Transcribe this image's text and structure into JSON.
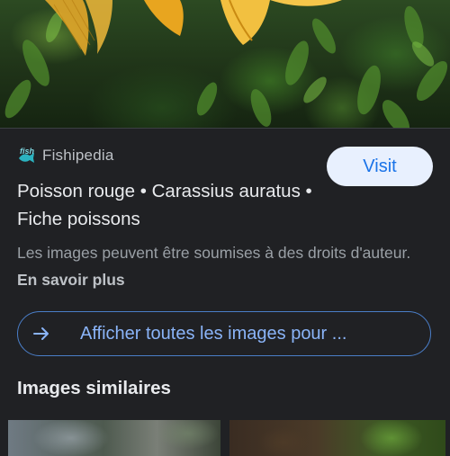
{
  "source": {
    "logo_icon": "fishipedia-logo-icon",
    "logo_text": "fish",
    "name": "Fishipedia"
  },
  "visit_button": {
    "label": "Visit"
  },
  "title": "Poisson rouge • Carassius auratus • Fiche poissons",
  "notice": {
    "text": "Les images peuvent être soumises à des droits d'auteur.",
    "learn_more": "En savoir plus"
  },
  "all_images": {
    "icon": "arrow-right-icon",
    "label": "Afficher toutes les images pour ..."
  },
  "similar": {
    "heading": "Images similaires"
  },
  "colors": {
    "background": "#202124",
    "accent": "#8ab4f8",
    "visit_bg": "#e8f0fe",
    "visit_text": "#1a73e8"
  }
}
